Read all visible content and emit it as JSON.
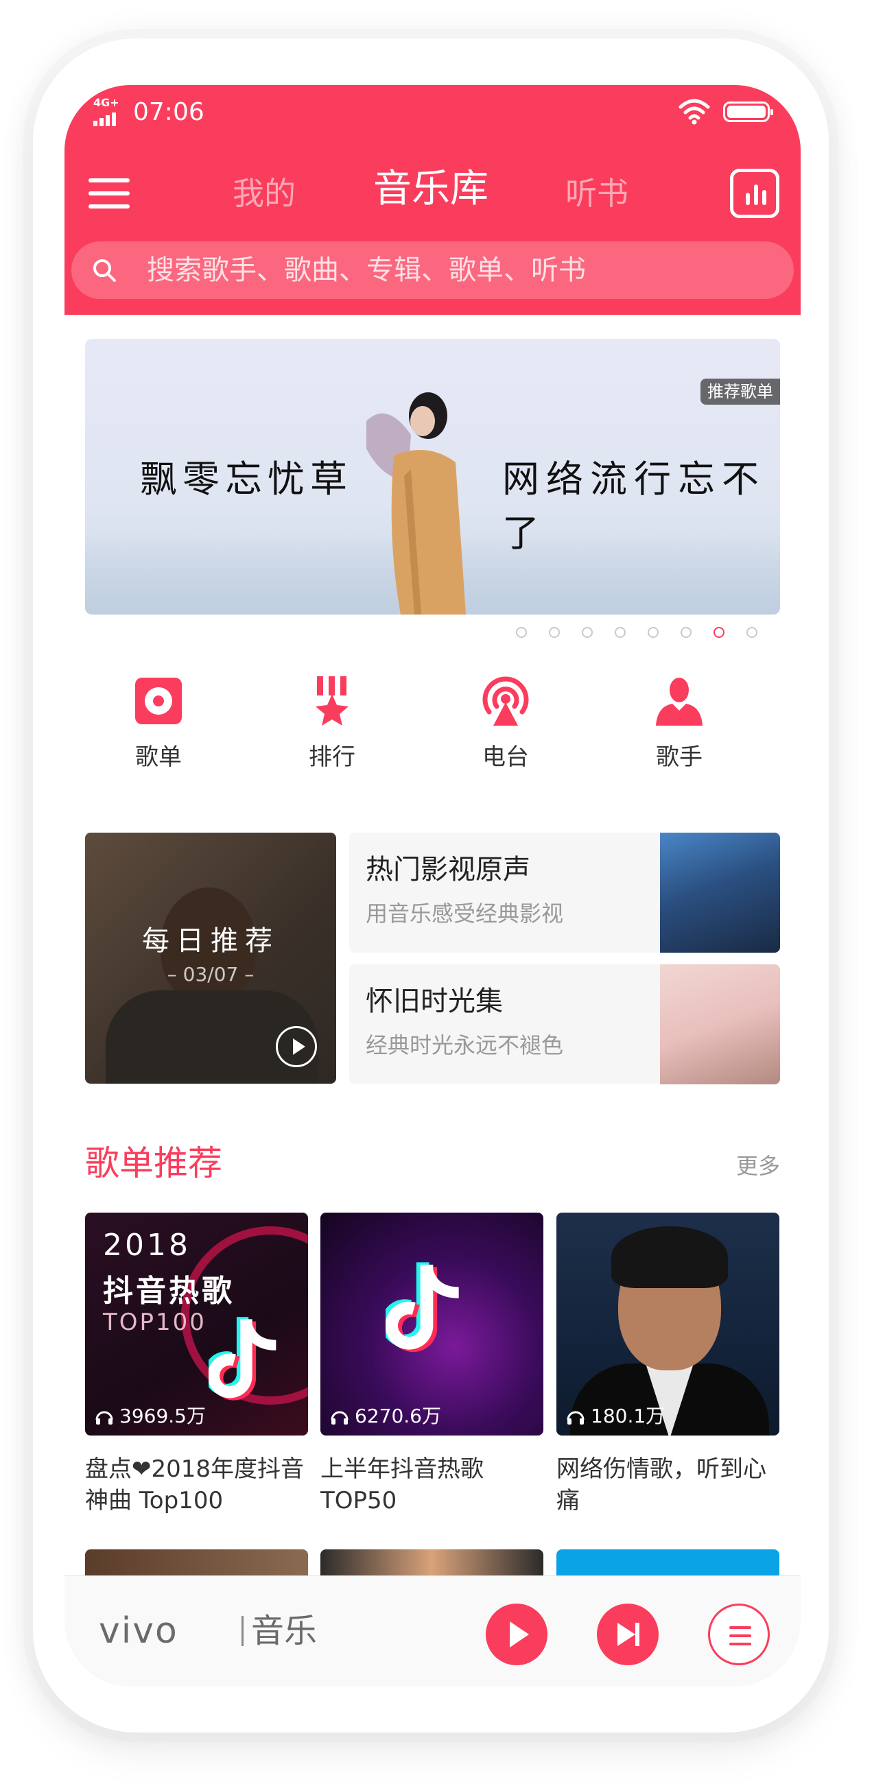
{
  "status_bar": {
    "network": "4G+",
    "time": "07:06"
  },
  "nav": {
    "tabs": [
      {
        "label": "我的",
        "active": false
      },
      {
        "label": "音乐库",
        "active": true
      },
      {
        "label": "听书",
        "active": false
      }
    ]
  },
  "search": {
    "placeholder": "搜索歌手、歌曲、专辑、歌单、听书"
  },
  "banner": {
    "text_left": "飘零忘忧草",
    "text_right": "网络流行忘不了",
    "badge": "推荐歌单",
    "page_count": 8,
    "active_page": 7
  },
  "quick_entries": [
    {
      "label": "歌单",
      "icon": "playlist-icon"
    },
    {
      "label": "排行",
      "icon": "ranking-icon"
    },
    {
      "label": "电台",
      "icon": "radio-icon"
    },
    {
      "label": "歌手",
      "icon": "singer-icon"
    }
  ],
  "daily": {
    "title": "每日推荐",
    "date": "– 03/07 –"
  },
  "features": [
    {
      "title": "热门影视原声",
      "subtitle": "用音乐感受经典影视"
    },
    {
      "title": "怀旧时光集",
      "subtitle": "经典时光永远不褪色"
    }
  ],
  "playlists_section": {
    "title": "歌单推荐",
    "more": "更多"
  },
  "playlists": [
    {
      "cover_year": "2018",
      "cover_title": "抖音热歌",
      "cover_top": "TOP100",
      "play_count": "3969.5万",
      "title": "盘点❤2018年度抖音神曲 Top100"
    },
    {
      "play_count": "6270.6万",
      "title": "上半年抖音热歌TOP50"
    },
    {
      "play_count": "180.1万",
      "title": "网络伤情歌，听到心痛"
    }
  ],
  "player": {
    "brand": "vivo",
    "app_name": "音乐"
  },
  "colors": {
    "accent": "#fa3d5c"
  }
}
